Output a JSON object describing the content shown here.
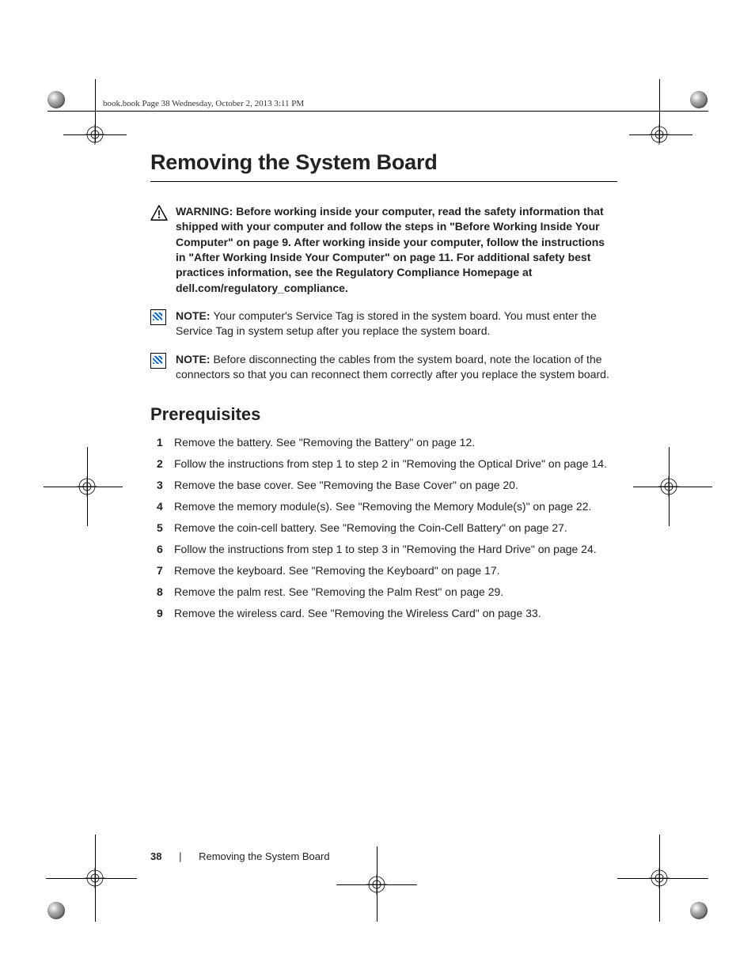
{
  "bookHeader": "book.book  Page 38  Wednesday, October 2, 2013  3:11 PM",
  "title": "Removing the System Board",
  "warning": {
    "label": "WARNING:  ",
    "text": "Before working inside your computer, read the safety information that shipped with your computer and follow the steps in \"Before Working Inside Your Computer\" on page 9. After working inside your computer, follow the instructions in \"After Working Inside Your Computer\" on page 11. For additional safety best practices information, see the Regulatory Compliance Homepage at dell.com/regulatory_compliance."
  },
  "note1": {
    "label": "NOTE: ",
    "text": "Your computer's Service Tag is stored in the system board. You must enter the Service Tag in system setup after you replace the system board."
  },
  "note2": {
    "label": "NOTE: ",
    "text": "Before disconnecting the cables from the system board, note the location of the connectors so that you can reconnect them correctly after you replace the system board."
  },
  "sectionTitle": "Prerequisites",
  "steps": [
    "Remove the battery. See \"Removing the Battery\" on page 12.",
    "Follow the instructions from step 1 to step 2 in \"Removing the Optical Drive\" on page 14.",
    "Remove the base cover. See \"Removing the Base Cover\" on page 20.",
    "Remove the memory module(s). See \"Removing the Memory Module(s)\" on page 22.",
    "Remove the coin-cell battery. See \"Removing the Coin-Cell Battery\" on page 27.",
    "Follow the instructions from step 1 to step 3 in \"Removing the Hard Drive\" on page 24.",
    "Remove the keyboard. See \"Removing the Keyboard\" on page 17.",
    "Remove the palm rest. See \"Removing the Palm Rest\" on page 29.",
    "Remove the wireless card. See \"Removing the Wireless Card\" on page 33."
  ],
  "footer": {
    "pageNumber": "38",
    "separator": "|",
    "title": "Removing the System Board"
  }
}
